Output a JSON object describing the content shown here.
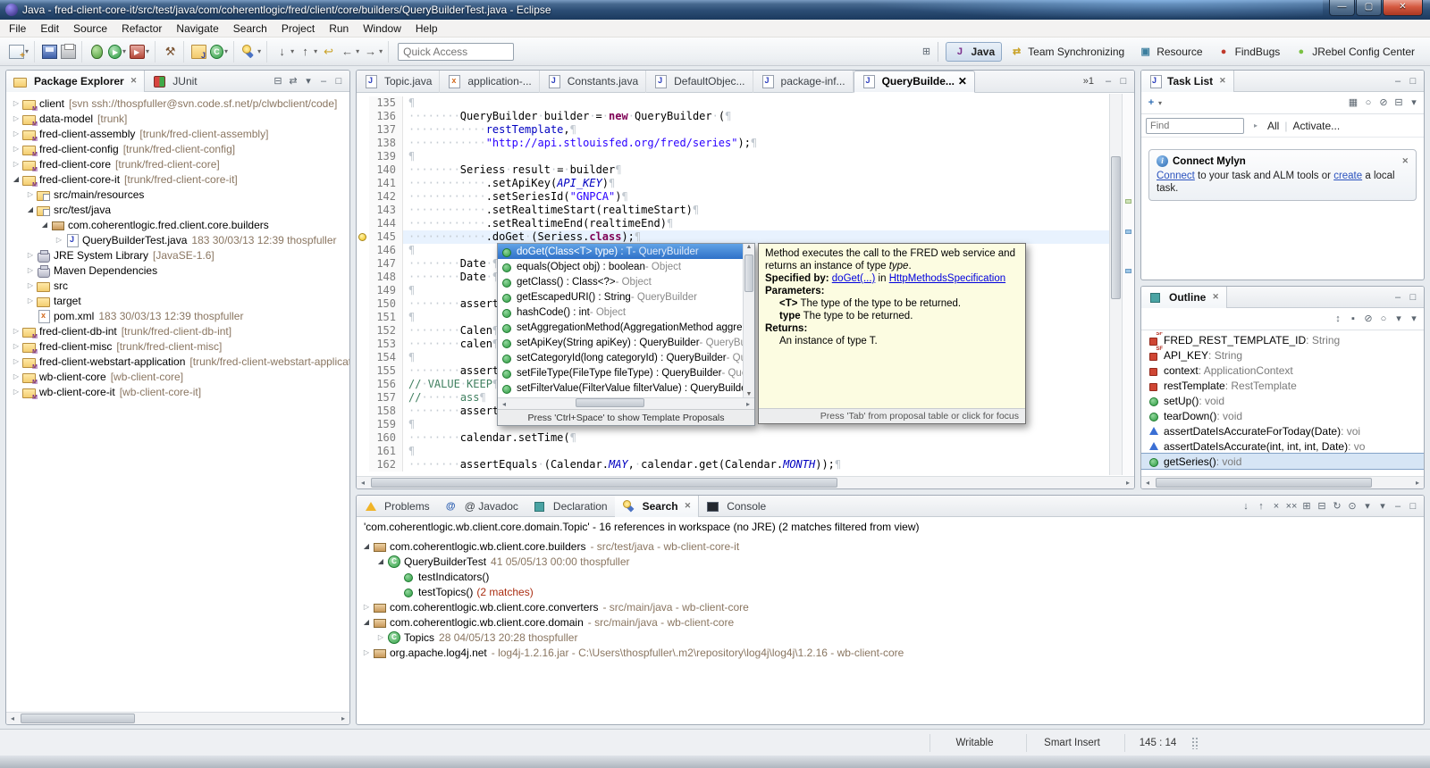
{
  "window": {
    "title": "Java - fred-client-core-it/src/test/java/com/coherentlogic/fred/client/core/builders/QueryBuilderTest.java - Eclipse"
  },
  "menu": [
    "File",
    "Edit",
    "Source",
    "Refactor",
    "Navigate",
    "Search",
    "Project",
    "Run",
    "Window",
    "Help"
  ],
  "toolbar": {
    "quick_access": "Quick Access",
    "groups": [
      [
        {
          "name": "new",
          "cls": "i-new",
          "dd": true
        }
      ],
      [
        {
          "name": "save",
          "cls": "i-save"
        },
        {
          "name": "print",
          "cls": "i-print"
        }
      ],
      [
        {
          "name": "debug",
          "cls": "i-debug"
        },
        {
          "name": "run",
          "cls": "i-run",
          "dd": true
        },
        {
          "name": "external-tools",
          "cls": "i-ext",
          "dd": true
        }
      ],
      [
        {
          "name": "build",
          "g": "⚒",
          "col": "#7a5230"
        }
      ],
      [
        {
          "name": "new-java-project",
          "cls": "i-njp"
        },
        {
          "name": "new-java-class",
          "cls": "i-njc",
          "dd": true
        }
      ],
      [
        {
          "name": "search",
          "cls": "i-search",
          "dd": true
        }
      ],
      [
        {
          "name": "next-annotation",
          "g": "↓",
          "dd": true
        },
        {
          "name": "previous-annotation",
          "g": "↑",
          "dd": true
        },
        {
          "name": "last-edit-location",
          "g": "↩",
          "col": "#c9a227"
        },
        {
          "name": "back",
          "g": "←",
          "dd": true
        },
        {
          "name": "forward",
          "g": "→",
          "dd": true
        }
      ]
    ],
    "perspectives": [
      {
        "label": "Java",
        "cls": "p-java",
        "active": true
      },
      {
        "label": "Team Synchronizing",
        "cls": "p-team"
      },
      {
        "label": "Resource",
        "cls": "p-res"
      },
      {
        "label": "FindBugs",
        "cls": "p-bugs"
      },
      {
        "label": "JRebel Config Center",
        "cls": "p-jrebel"
      }
    ]
  },
  "package_explorer": {
    "tab": "Package Explorer",
    "tab_junit": "JUnit",
    "header_icons": [
      "collapse-all",
      "link-with-editor",
      "view-menu",
      "minimize",
      "maximize"
    ],
    "items": [
      {
        "lv": 0,
        "ex": "c",
        "ic": "prj",
        "t": "client",
        "d": "[svn ssh://thospfuller@svn.code.sf.net/p/clwbclient/code]"
      },
      {
        "lv": 0,
        "ex": "c",
        "ic": "prj",
        "t": "data-model",
        "d": "[trunk]"
      },
      {
        "lv": 0,
        "ex": "c",
        "ic": "prj",
        "t": "fred-client-assembly",
        "d": "[trunk/fred-client-assembly]"
      },
      {
        "lv": 0,
        "ex": "c",
        "ic": "prj",
        "t": "fred-client-config",
        "d": "[trunk/fred-client-config]"
      },
      {
        "lv": 0,
        "ex": "c",
        "ic": "prj",
        "t": "fred-client-core",
        "d": "[trunk/fred-client-core]"
      },
      {
        "lv": 0,
        "ex": "e",
        "ic": "prj",
        "t": "fred-client-core-it",
        "d": "[trunk/fred-client-core-it]"
      },
      {
        "lv": 1,
        "ex": "c",
        "ic": "srcpkg",
        "t": "src/main/resources",
        "d": ""
      },
      {
        "lv": 1,
        "ex": "e",
        "ic": "srcpkg",
        "t": "src/test/java",
        "d": ""
      },
      {
        "lv": 2,
        "ex": "e",
        "ic": "pkg",
        "t": "com.coherentlogic.fred.client.core.builders",
        "d": ""
      },
      {
        "lv": 3,
        "ex": "c",
        "ic": "jfile",
        "t": "QueryBuilderTest.java",
        "d": "183 30/03/13 12:39 thospfuller"
      },
      {
        "lv": 1,
        "ex": "c",
        "ic": "lib",
        "t": "JRE System Library",
        "d": "[JavaSE-1.6]"
      },
      {
        "lv": 1,
        "ex": "c",
        "ic": "lib",
        "t": "Maven Dependencies",
        "d": ""
      },
      {
        "lv": 1,
        "ex": "c",
        "ic": "fold",
        "t": "src",
        "d": ""
      },
      {
        "lv": 1,
        "ex": "c",
        "ic": "fold",
        "t": "target",
        "d": ""
      },
      {
        "lv": 1,
        "ex": "n",
        "ic": "xml",
        "t": "pom.xml",
        "d": "183 30/03/13 12:39 thospfuller"
      },
      {
        "lv": 0,
        "ex": "c",
        "ic": "prj",
        "t": "fred-client-db-int",
        "d": "[trunk/fred-client-db-int]"
      },
      {
        "lv": 0,
        "ex": "c",
        "ic": "prj",
        "t": "fred-client-misc",
        "d": "[trunk/fred-client-misc]"
      },
      {
        "lv": 0,
        "ex": "c",
        "ic": "prj",
        "t": "fred-client-webstart-application",
        "d": "[trunk/fred-client-webstart-application]"
      },
      {
        "lv": 0,
        "ex": "c",
        "ic": "prj",
        "t": "wb-client-core",
        "d": "[wb-client-core]"
      },
      {
        "lv": 0,
        "ex": "c",
        "ic": "prj",
        "t": "wb-client-core-it",
        "d": "[wb-client-core-it]"
      }
    ]
  },
  "editor": {
    "tabs": [
      {
        "t": "Topic.java",
        "ic": "j"
      },
      {
        "t": "application-...",
        "ic": "x"
      },
      {
        "t": "Constants.java",
        "ic": "j"
      },
      {
        "t": "DefaultObjec...",
        "ic": "j"
      },
      {
        "t": "package-inf...",
        "ic": "j"
      },
      {
        "t": "QueryBuilde...",
        "ic": "j",
        "active": true,
        "close": true
      }
    ],
    "overflow": "»1",
    "header_icons": [
      "minimize",
      "maximize"
    ],
    "lines": [
      {
        "n": 135,
        "s": []
      },
      {
        "n": 136,
        "s": [
          [
            "pl",
            "········QueryBuilder·builder·=·"
          ],
          [
            "kw",
            "new"
          ],
          [
            "pl",
            "·QueryBuilder·("
          ]
        ]
      },
      {
        "n": 137,
        "s": [
          [
            "pl",
            "············"
          ],
          [
            "fl",
            "restTemplate"
          ],
          [
            "pl",
            ","
          ]
        ]
      },
      {
        "n": 138,
        "s": [
          [
            "pl",
            "············"
          ],
          [
            "st",
            "\"http://api.stlouisfed.org/fred/series\""
          ],
          [
            "pl",
            ");"
          ]
        ]
      },
      {
        "n": 139,
        "s": []
      },
      {
        "n": 140,
        "s": [
          [
            "pl",
            "········Seriess·result·=·builder"
          ]
        ]
      },
      {
        "n": 141,
        "s": [
          [
            "pl",
            "············.setApiKey("
          ],
          [
            "fli",
            "API_KEY"
          ],
          [
            "pl",
            ")"
          ]
        ]
      },
      {
        "n": 142,
        "s": [
          [
            "pl",
            "············.setSeriesId("
          ],
          [
            "st",
            "\"GNPCA\""
          ],
          [
            "pl",
            ")"
          ]
        ]
      },
      {
        "n": 143,
        "s": [
          [
            "pl",
            "············.setRealtimeStart(realtimeStart)"
          ]
        ]
      },
      {
        "n": 144,
        "s": [
          [
            "pl",
            "············.setRealtimeEnd(realtimeEnd)"
          ]
        ]
      },
      {
        "n": 145,
        "cur": true,
        "bulb": true,
        "s": [
          [
            "pl",
            "············.doGet·(Seriess."
          ],
          [
            "kw",
            "class"
          ],
          [
            "pl",
            ");"
          ]
        ]
      },
      {
        "n": 146,
        "s": []
      },
      {
        "n": 147,
        "s": [
          [
            "pl",
            "········Date·"
          ]
        ]
      },
      {
        "n": 148,
        "s": [
          [
            "pl",
            "········Date·"
          ]
        ]
      },
      {
        "n": 149,
        "s": []
      },
      {
        "n": 150,
        "s": [
          [
            "pl",
            "········assert"
          ]
        ]
      },
      {
        "n": 151,
        "s": []
      },
      {
        "n": 152,
        "s": [
          [
            "pl",
            "········Calen"
          ]
        ]
      },
      {
        "n": 153,
        "s": [
          [
            "pl",
            "········calen"
          ]
        ]
      },
      {
        "n": 154,
        "s": []
      },
      {
        "n": 155,
        "s": [
          [
            "pl",
            "········assert"
          ]
        ]
      },
      {
        "n": 156,
        "s": [
          [
            "cm",
            "//·VALUE·KEEP"
          ]
        ]
      },
      {
        "n": 157,
        "s": [
          [
            "cm",
            "//······ass"
          ]
        ]
      },
      {
        "n": 158,
        "s": [
          [
            "pl",
            "········assert"
          ]
        ]
      },
      {
        "n": 159,
        "s": []
      },
      {
        "n": 160,
        "s": [
          [
            "pl",
            "········calendar.setTime("
          ]
        ]
      },
      {
        "n": 161,
        "s": []
      },
      {
        "n": 162,
        "s": [
          [
            "pl",
            "········assertEquals·(Calendar."
          ],
          [
            "fli",
            "MAY"
          ],
          [
            "pl",
            ",·calendar.get(Calendar."
          ],
          [
            "fli",
            "MONTH"
          ],
          [
            "pl",
            "));"
          ]
        ]
      }
    ]
  },
  "popup": {
    "items": [
      {
        "m": "doGet(Class<T> type) : T",
        "o": "QueryBuilder",
        "sel": true
      },
      {
        "m": "equals(Object obj) : boolean",
        "o": "Object"
      },
      {
        "m": "getClass() : Class<?>",
        "o": "Object"
      },
      {
        "m": "getEscapedURI() : String",
        "o": "QueryBuilder"
      },
      {
        "m": "hashCode() : int",
        "o": "Object"
      },
      {
        "m": "setAggregationMethod(AggregationMethod aggregationM",
        "o": ""
      },
      {
        "m": "setApiKey(String apiKey) : QueryBuilder",
        "o": "QueryBuilder"
      },
      {
        "m": "setCategoryId(long categoryId) : QueryBuilder",
        "o": "QueryBui"
      },
      {
        "m": "setFileType(FileType fileType) : QueryBuilder",
        "o": "QueryBuilde"
      },
      {
        "m": "setFilterValue(FilterValue filterValue) : QueryBuilder",
        "o": "Query"
      }
    ],
    "footer": "Press 'Ctrl+Space' to show Template Proposals"
  },
  "javadoc": {
    "p1a": "Method executes the call to the FRED web service and returns an instance of type ",
    "p1em": "type",
    "p1b": ".",
    "specified_label": "Specified by:",
    "specified_link": "doGet(...)",
    "specified_mid": " in ",
    "specified_link2": "HttpMethodsSpecification",
    "parameters_label": "Parameters:",
    "param1_name": "<T>",
    "param1_desc": " The type of the type to be returned.",
    "param2_name": "type",
    "param2_desc": " The type to be returned.",
    "returns_label": "Returns:",
    "returns_desc": "An instance of type T.",
    "footer": "Press 'Tab' from proposal table or click for focus"
  },
  "task_list": {
    "tab": "Task List",
    "header_icons": [
      "minimize",
      "maximize"
    ],
    "toolbar_icons": [
      "categorized",
      "scheduled",
      "filter-tasks",
      "collapse-all",
      "view-menu"
    ],
    "find_placeholder": "Find",
    "all_label": "All",
    "activate_label": "Activate...",
    "mylyn_title": "Connect Mylyn",
    "mylyn_link1": "Connect",
    "mylyn_mid": " to your task and ALM tools or ",
    "mylyn_link2": "create",
    "mylyn_end": " a local task."
  },
  "outline": {
    "tab": "Outline",
    "header_icons": [
      "minimize",
      "maximize"
    ],
    "toolbar_icons": [
      "sort",
      "hide-fields",
      "hide-static",
      "hide-non-public",
      "filters",
      "view-menu"
    ],
    "items": [
      {
        "ic": "fsf",
        "t": "FRED_REST_TEMPLATE_ID",
        "ty": "String"
      },
      {
        "ic": "fsf",
        "t": "API_KEY",
        "ty": "String"
      },
      {
        "ic": "fpriv",
        "t": "context",
        "ty": "ApplicationContext"
      },
      {
        "ic": "fpriv",
        "t": "restTemplate",
        "ty": "RestTemplate"
      },
      {
        "ic": "mpub",
        "t": "setUp()",
        "ty": "void"
      },
      {
        "ic": "mpub",
        "t": "tearDown()",
        "ty": "void"
      },
      {
        "ic": "mdef",
        "t": "assertDateIsAccurateForToday(Date)",
        "ty": "voi"
      },
      {
        "ic": "mdef",
        "t": "assertDateIsAccurate(int, int, int, Date)",
        "ty": "vo"
      },
      {
        "ic": "mpub",
        "t": "getSeries()",
        "ty": "void",
        "sel": true
      }
    ]
  },
  "search_view": {
    "tabs": [
      {
        "t": "Problems",
        "ic": "problems"
      },
      {
        "t": "@ Javadoc",
        "ic": "javadoc"
      },
      {
        "t": "Declaration",
        "ic": "decl"
      },
      {
        "t": "Search",
        "ic": "searchtab",
        "active": true,
        "close": true
      },
      {
        "t": "Console",
        "ic": "console"
      }
    ],
    "toolbar_icons": [
      "next-match",
      "previous-match",
      "remove-selected",
      "remove-all-matches",
      "expand-all",
      "collapse-all",
      "run-current-search",
      "pin-view",
      "search-history",
      "view-menu",
      "minimize",
      "maximize"
    ],
    "header": "'com.coherentlogic.wb.client.core.domain.Topic' - 16 references in workspace (no JRE) (2 matches filtered from view)",
    "rows": [
      {
        "lv": 0,
        "ex": "e",
        "ic": "pkg",
        "t": "com.coherentlogic.wb.client.core.builders",
        "d": "- src/test/java - wb-client-core-it"
      },
      {
        "lv": 1,
        "ex": "e",
        "ic": "cls",
        "t": "QueryBuilderTest",
        "d": "41 05/05/13 00:00 thospfuller"
      },
      {
        "lv": 2,
        "ex": "n",
        "ic": "mpub",
        "t": "testIndicators()",
        "d": ""
      },
      {
        "lv": 2,
        "ex": "n",
        "ic": "mpub",
        "t": "testTopics()",
        "d": "",
        "m": "(2 matches)"
      },
      {
        "lv": 0,
        "ex": "c",
        "ic": "pkg",
        "t": "com.coherentlogic.wb.client.core.converters",
        "d": "- src/main/java - wb-client-core"
      },
      {
        "lv": 0,
        "ex": "e",
        "ic": "pkg",
        "t": "com.coherentlogic.wb.client.core.domain",
        "d": "- src/main/java - wb-client-core"
      },
      {
        "lv": 1,
        "ex": "c",
        "ic": "cls",
        "t": "Topics",
        "d": "28 04/05/13 20:28 thospfuller"
      },
      {
        "lv": 0,
        "ex": "c",
        "ic": "pkg",
        "t": "org.apache.log4j.net",
        "d": "- log4j-1.2.16.jar - C:\\Users\\thospfuller\\.m2\\repository\\log4j\\log4j\\1.2.16 - wb-client-core"
      }
    ]
  },
  "status_bar": {
    "writable": "Writable",
    "mode": "Smart Insert",
    "position": "145 : 14"
  }
}
